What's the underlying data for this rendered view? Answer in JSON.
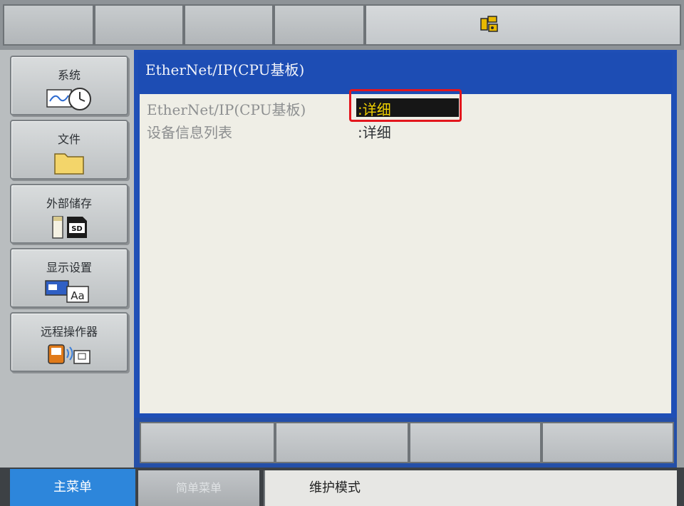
{
  "colors": {
    "title_bar": "#1d4db4",
    "selection_bg": "#161616",
    "selection_text": "#f0d000",
    "annotation": "#e3161d",
    "main_menu_active": "#2d86db"
  },
  "top_bar": {
    "robot_icon": "robot-status-icon"
  },
  "sidebar": {
    "items": [
      {
        "label": "系统",
        "icon": "system-clock-icon"
      },
      {
        "label": "文件",
        "icon": "folder-icon"
      },
      {
        "label": "外部储存",
        "icon": "sd-card-icon"
      },
      {
        "label": "显示设置",
        "icon": "display-settings-icon"
      },
      {
        "label": "远程操作器",
        "icon": "remote-operator-icon"
      }
    ]
  },
  "screen": {
    "title": "EtherNet/IP(CPU基板)",
    "rows": [
      {
        "label": "EtherNet/IP(CPU基板)",
        "value": ":详细",
        "selected": true
      },
      {
        "label": "设备信息列表",
        "value": ":详细",
        "selected": false
      }
    ]
  },
  "bottom": {
    "main_menu": "主菜单",
    "simple_menu": "简单菜单",
    "status": "维护模式"
  }
}
